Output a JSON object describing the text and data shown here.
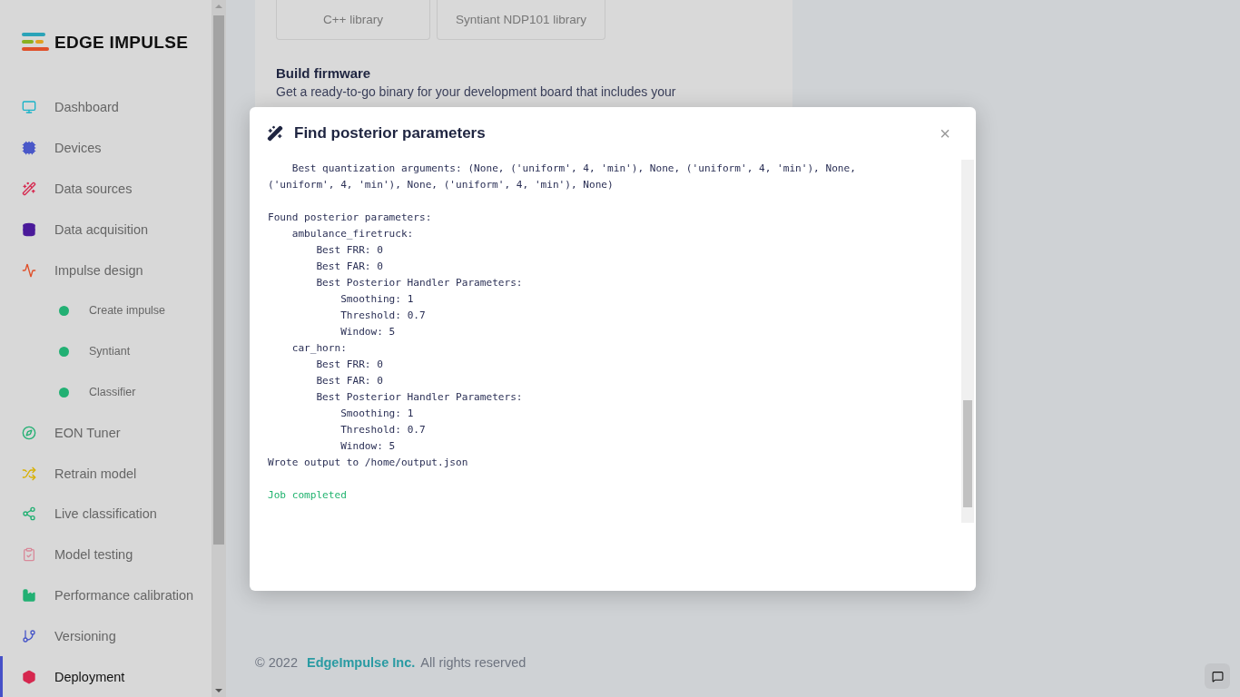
{
  "sidebar": {
    "logo": "EDGE IMPULSE",
    "items": [
      {
        "label": "Dashboard",
        "kind": "main",
        "selected": false
      },
      {
        "label": "Devices",
        "kind": "main",
        "selected": false
      },
      {
        "label": "Data sources",
        "kind": "main",
        "selected": false
      },
      {
        "label": "Data acquisition",
        "kind": "main",
        "selected": false
      },
      {
        "label": "Impulse design",
        "kind": "main",
        "selected": false
      },
      {
        "label": "Create impulse",
        "kind": "sub",
        "selected": false
      },
      {
        "label": "Syntiant",
        "kind": "sub",
        "selected": false
      },
      {
        "label": "Classifier",
        "kind": "sub",
        "selected": false
      },
      {
        "label": "EON Tuner",
        "kind": "main",
        "selected": false
      },
      {
        "label": "Retrain model",
        "kind": "main",
        "selected": false
      },
      {
        "label": "Live classification",
        "kind": "main",
        "selected": false
      },
      {
        "label": "Model testing",
        "kind": "main",
        "selected": false
      },
      {
        "label": "Performance calibration",
        "kind": "main",
        "selected": false
      },
      {
        "label": "Versioning",
        "kind": "main",
        "selected": false
      },
      {
        "label": "Deployment",
        "kind": "main",
        "selected": true
      }
    ]
  },
  "card": {
    "buttons": [
      "C++ library",
      "Syntiant NDP101 library"
    ],
    "heading": "Build firmware",
    "text": "Get a ready-to-go binary for your development board that includes your"
  },
  "footer": {
    "copyright": "© 2022",
    "link": "EdgeImpulse Inc.",
    "rest": "All rights reserved"
  },
  "modal": {
    "title": "Find posterior parameters",
    "close": "×",
    "log_blocks": [
      {
        "lines": [
          {
            "text": "    Best quantization arguments: (None, ('uniform', 4, 'min'), None, ('uniform', 4, 'min'), None, ('uniform', 4, 'min'), None, ('uniform', 4, 'min'), None)",
            "kind": "normal"
          }
        ]
      },
      {
        "lines": [
          {
            "text": "Found posterior parameters:",
            "kind": "normal"
          },
          {
            "text": "    ambulance_firetruck:",
            "kind": "normal"
          },
          {
            "text": "        Best FRR: 0",
            "kind": "normal"
          },
          {
            "text": "        Best FAR: 0",
            "kind": "normal"
          },
          {
            "text": "        Best Posterior Handler Parameters:",
            "kind": "normal"
          },
          {
            "text": "            Smoothing: 1",
            "kind": "normal"
          },
          {
            "text": "            Threshold: 0.7",
            "kind": "normal"
          },
          {
            "text": "            Window: 5",
            "kind": "normal"
          },
          {
            "text": "    car_horn:",
            "kind": "normal"
          },
          {
            "text": "        Best FRR: 0",
            "kind": "normal"
          },
          {
            "text": "        Best FAR: 0",
            "kind": "normal"
          },
          {
            "text": "        Best Posterior Handler Parameters:",
            "kind": "normal"
          },
          {
            "text": "            Smoothing: 1",
            "kind": "normal"
          },
          {
            "text": "            Threshold: 0.7",
            "kind": "normal"
          },
          {
            "text": "            Window: 5",
            "kind": "normal"
          },
          {
            "text": "Wrote output to /home/output.json",
            "kind": "normal"
          }
        ]
      },
      {
        "lines": [
          {
            "text": "Job completed",
            "kind": "success"
          }
        ]
      }
    ]
  }
}
